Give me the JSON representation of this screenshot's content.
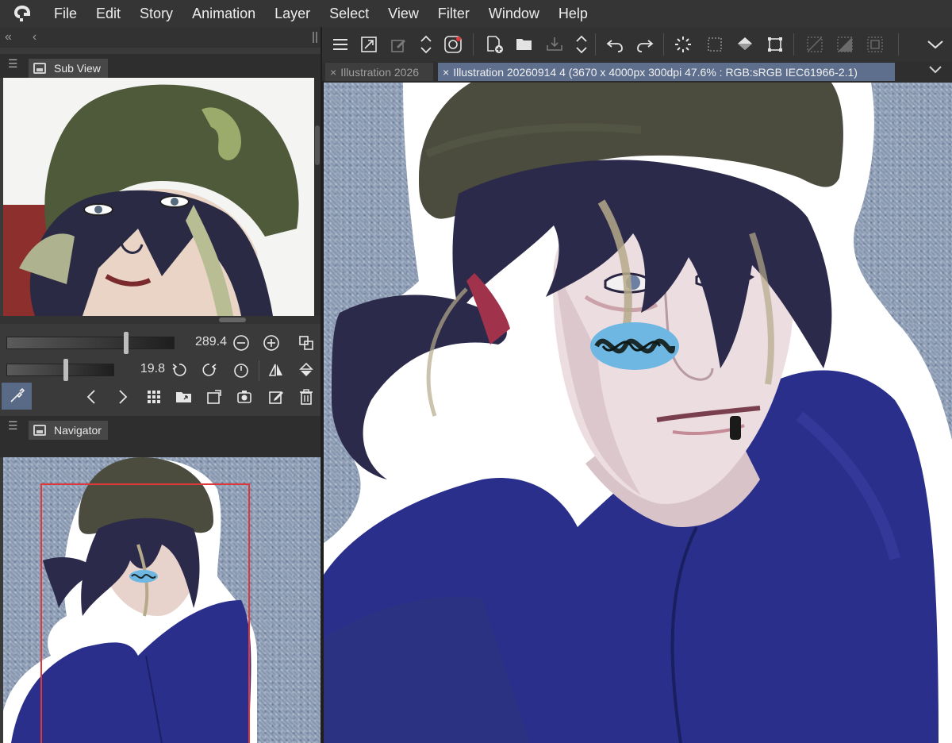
{
  "menu": {
    "logo": "clip-studio-logo-icon",
    "items": [
      "File",
      "Edit",
      "Story",
      "Animation",
      "Layer",
      "Select",
      "View",
      "Filter",
      "Window",
      "Help"
    ]
  },
  "left_panel": {
    "collapse_glyph": "«",
    "back_glyph": "‹",
    "subview": {
      "tab_label": "Sub View",
      "zoom_value": "289.4",
      "rotate_value": "19.8"
    },
    "navigator": {
      "tab_label": "Navigator"
    }
  },
  "toolbar": {
    "icons": [
      "menu-icon",
      "fit-icon",
      "edit-icon",
      "stepper-icon",
      "companion-icon",
      "new-file-icon",
      "open-icon",
      "export-icon",
      "stepper-icon",
      "undo-icon",
      "redo-icon",
      "spinner-icon",
      "select-icon",
      "fill-icon",
      "transform-icon",
      "deselect-icon",
      "invert-icon",
      "border-icon",
      "collapse-icon"
    ]
  },
  "tabs": {
    "inactive_label": "Illustration 2026",
    "active_label": "Illustration 20260914 4 (3670 x 4000px 300dpi 47.6% : RGB:sRGB IEC61966-2.1)",
    "close_glyph": "×",
    "menu_glyph": "⌄"
  },
  "colors": {
    "accent_active_tab": "#5e6e8d",
    "eyedropper_active": "#596a86",
    "navigator_frame": "#e0383a",
    "denim_blue": "#8fa0b9",
    "sweater_blue": "#2a2f8c",
    "helmet_olive": "#4b4c3e"
  }
}
